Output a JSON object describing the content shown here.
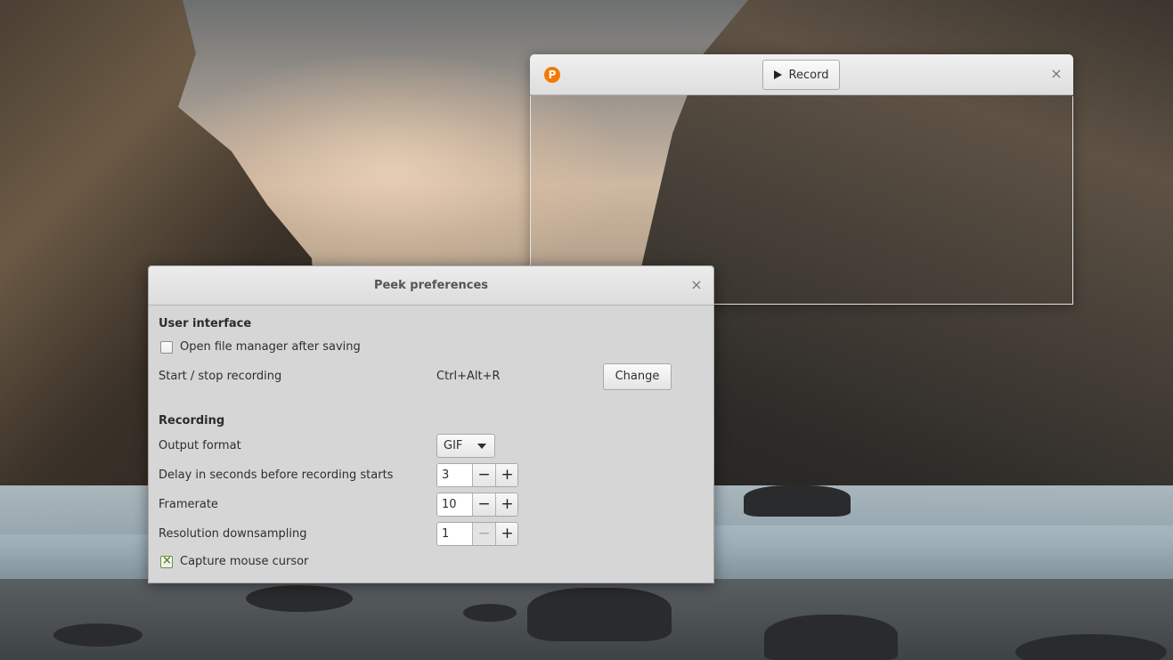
{
  "recorder": {
    "logo_glyph": "P",
    "record_label": "Record",
    "close_glyph": "×"
  },
  "preferences": {
    "title": "Peek preferences",
    "close_glyph": "×",
    "user_interface": {
      "heading": "User interface",
      "open_file_manager": {
        "label": "Open file manager after saving",
        "checked": false
      },
      "start_stop": {
        "label": "Start / stop recording",
        "shortcut": "Ctrl+Alt+R",
        "button_label": "Change"
      }
    },
    "recording": {
      "heading": "Recording",
      "output_format": {
        "label": "Output format",
        "value": "GIF"
      },
      "delay": {
        "label": "Delay in seconds before recording starts",
        "value": "3",
        "minus": "−",
        "plus": "+"
      },
      "framerate": {
        "label": "Framerate",
        "value": "10",
        "minus": "−",
        "plus": "+"
      },
      "downsampling": {
        "label": "Resolution downsampling",
        "value": "1",
        "minus": "−",
        "plus": "+",
        "minus_disabled": true
      },
      "capture_cursor": {
        "label": "Capture mouse cursor",
        "checked": true
      }
    }
  }
}
